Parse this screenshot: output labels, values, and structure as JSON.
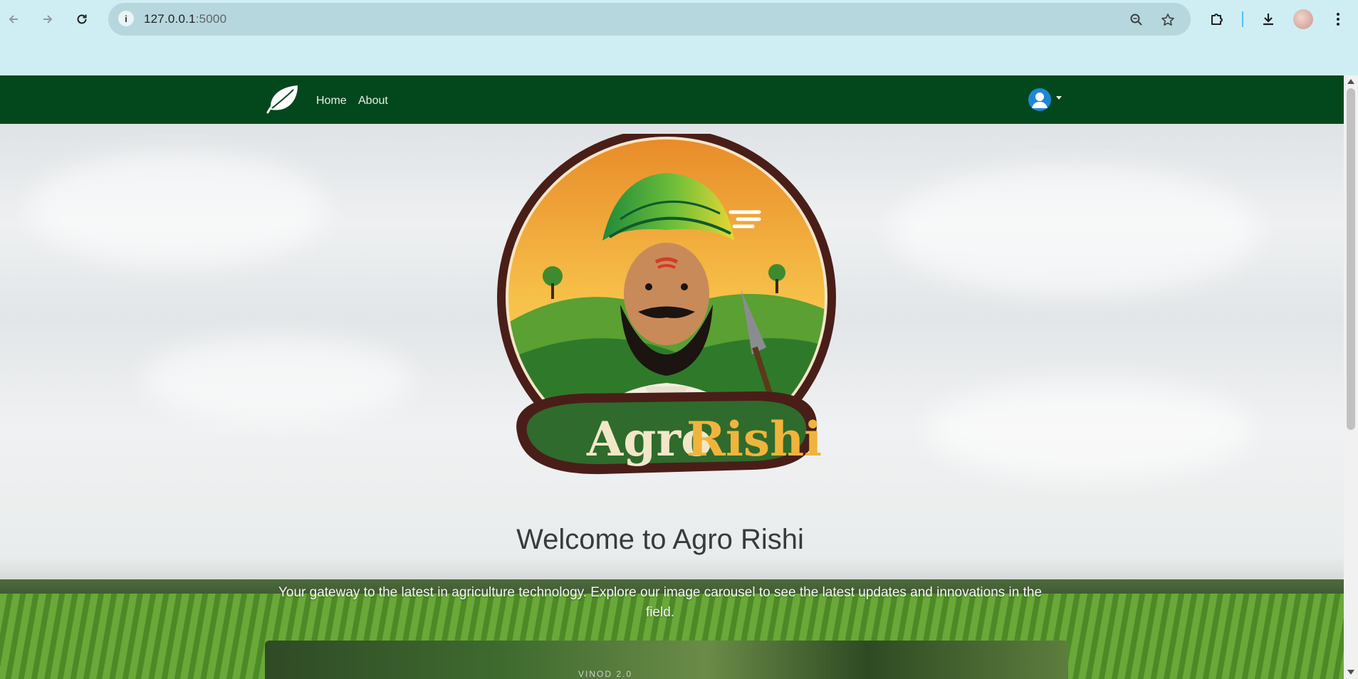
{
  "browser": {
    "url_host": "127.0.0.1",
    "url_port": ":5000",
    "back_icon": "arrow-left-icon",
    "forward_icon": "arrow-right-icon",
    "reload_icon": "reload-icon",
    "site_info_icon": "info-icon",
    "zoom_icon": "zoom-icon",
    "bookmark_icon": "star-icon",
    "extensions_icon": "puzzle-icon",
    "download_icon": "download-icon",
    "menu_icon": "kebab-menu-icon"
  },
  "navbar": {
    "background": "#03481c",
    "links": [
      {
        "label": "Home"
      },
      {
        "label": "About"
      }
    ],
    "brand_icon": "leaf-icon",
    "user_icon": "user-circle-icon"
  },
  "hero": {
    "logo_text_1": "Agro",
    "logo_text_2": "Rishi",
    "title": "Welcome to Agro Rishi",
    "tagline": "Your gateway to the latest in agriculture technology. Explore our image carousel to see the latest updates and innovations in the field.",
    "carousel_watermark": "VINOD 2.0"
  },
  "colors": {
    "accent_green": "#03481c",
    "logo_gold": "#f0b43c",
    "logo_cream": "#f2e6c9"
  }
}
